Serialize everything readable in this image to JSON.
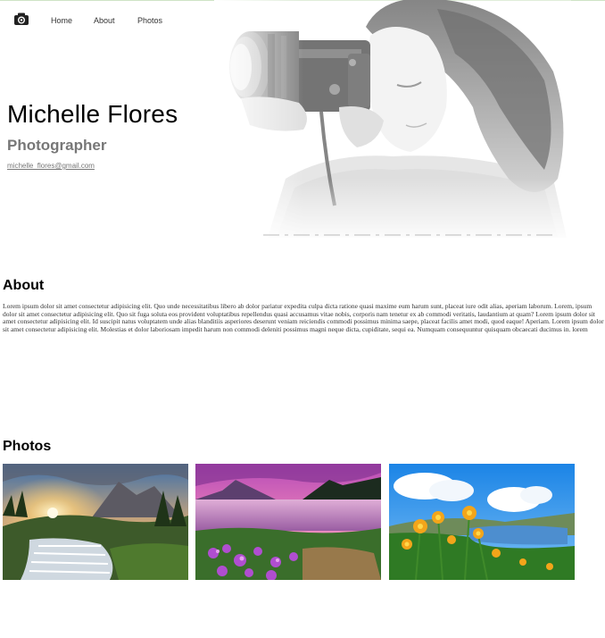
{
  "nav": {
    "logo_icon": "camera-icon",
    "home": "Home",
    "about": "About",
    "photos": "Photos"
  },
  "hero": {
    "name": "Michelle Flores",
    "title": "Photographer",
    "email": "michelle_flores@gmail.com",
    "image_icon": "photographer-photo"
  },
  "about": {
    "heading": "About",
    "text": "Lorem ipsum dolor sit amet consectetur adipisicing elit. Quo unde necessitatibus libero ab dolor pariatur expedita culpa dicta ratione quasi maxime eum harum sunt, placeat iure odit alias, aperiam laborum. Lorem, ipsum dolor sit amet consectetur adipisicing elit. Quo sit fuga soluta eos provident voluptatibus repellendus quasi accusamus vitae nobis, corporis nam tenetur ex ab commodi veritatis, laudantium at quam? Lorem ipsum dolor sit amet consectetur adipisicing elit. Id suscipit natus voluptatem unde alias blanditiis asperiores deserunt veniam reiciendis commodi possimus minima saepe, placeat facilis amet modi, quod eaque! Aperiam. Lorem ipsum dolor sit amet consectetur adipisicing elit. Molestias et dolor laboriosam impedit harum non commodi deleniti possimus magni neque dicta, cupiditate, sequi ea. Numquam consequuntur quisquam obcaecati ducimus in. lorem"
  },
  "photos": {
    "heading": "Photos",
    "items": [
      {
        "icon": "waterfall-sunset-photo"
      },
      {
        "icon": "purple-lake-mountain-photo"
      },
      {
        "icon": "yellow-flowers-lake-photo"
      }
    ]
  },
  "colors": {
    "heading": "#000000",
    "subtitle": "#777777",
    "body_text": "#333333"
  }
}
